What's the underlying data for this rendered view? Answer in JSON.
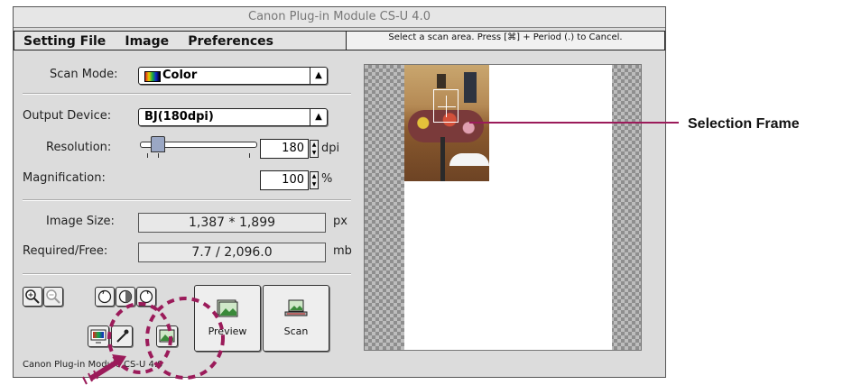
{
  "window": {
    "title": "Canon Plug-in Module CS-U 4.0",
    "menu": [
      "Setting File",
      "Image",
      "Preferences"
    ],
    "status_message": "Select a scan area. Press [⌘] + Period (.) to Cancel."
  },
  "form": {
    "scan_mode_label": "Scan Mode:",
    "scan_mode_value": "Color",
    "output_device_label": "Output Device:",
    "output_device_value": "BJ(180dpi)",
    "resolution_label": "Resolution:",
    "resolution_value": "180",
    "resolution_unit": "dpi",
    "magnification_label": "Magnification:",
    "magnification_value": "100",
    "magnification_unit": "%",
    "image_size_label": "Image Size:",
    "image_size_value": "1,387 * 1,899",
    "image_size_unit": "px",
    "required_free_label": "Required/Free:",
    "required_free_value": "7.7 / 2,096.0",
    "required_free_unit": "mb"
  },
  "buttons": {
    "preview": "Preview",
    "scan": "Scan"
  },
  "footer_text": "Canon Plug-in Module CS-U 4.0",
  "callout": "Selection Frame",
  "colors": {
    "annotation": "#9b1b5a"
  }
}
